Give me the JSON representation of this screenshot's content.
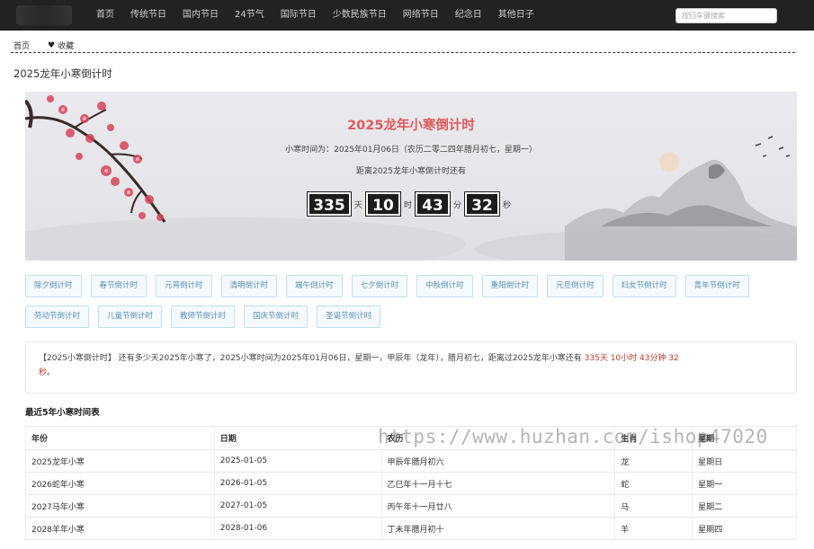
{
  "nav": {
    "items": [
      "首页",
      "传统节日",
      "国内节日",
      "24节气",
      "国际节日",
      "少数民族节日",
      "网络节日",
      "纪念日",
      "其他日子"
    ],
    "search_placeholder": "按回车键搜索"
  },
  "breadcrumb": {
    "home": "首页",
    "favorite": "收藏"
  },
  "page_title": "2025龙年小寒倒计时",
  "banner": {
    "title": "2025龙年小寒倒计时",
    "time_line": "小寒时间为：2025年01月06日（农历二零二四年腊月初七，星期一）",
    "remaining_line": "距离2025龙年小寒倒计时还有",
    "countdown": {
      "days": "335",
      "days_unit": "天",
      "hours": "10",
      "hours_unit": "时",
      "minutes": "43",
      "minutes_unit": "分",
      "seconds": "32",
      "seconds_unit": "秒"
    }
  },
  "festival_buttons": {
    "row1": [
      "除夕倒计时",
      "春节倒计时",
      "元宵倒计时",
      "清明倒计时",
      "端午倒计时",
      "七夕倒计时",
      "中秋倒计时",
      "重阳倒计时",
      "元旦倒计时",
      "妇女节倒计时",
      "青年节倒计时"
    ],
    "row2": [
      "劳动节倒计时",
      "儿童节倒计时",
      "教师节倒计时",
      "国庆节倒计时",
      "圣诞节倒计时"
    ]
  },
  "description": {
    "text": "【2025小寒倒计时】 还有多少天2025年小寒了，2025小寒时间为2025年01月06日，星期一，甲辰年（龙年），腊月初七，距离过2025龙年小寒还有 ",
    "highlight_main": "335天 10小时 43分钟 32",
    "highlight_tail": "秒",
    "end": "。"
  },
  "table": {
    "title": "最近5年小寒时间表",
    "headers": [
      "年份",
      "日期",
      "农历",
      "生肖",
      "星期"
    ],
    "rows": [
      [
        "2025龙年小寒",
        "2025-01-05",
        "甲辰年腊月初六",
        "龙",
        "星期日"
      ],
      [
        "2026蛇年小寒",
        "2026-01-05",
        "乙巳年十一月十七",
        "蛇",
        "星期一"
      ],
      [
        "2027马年小寒",
        "2027-01-05",
        "丙午年十一月廿八",
        "马",
        "星期二"
      ],
      [
        "2028羊年小寒",
        "2028-01-06",
        "丁未年腊月初十",
        "羊",
        "星期四"
      ]
    ]
  },
  "watermark": "https://www.huzhan.com/ishop47020",
  "colors": {
    "topbar": "#222222",
    "title_red": "#e05a5a",
    "highlight": "#c0392b",
    "button_border": "#bfe0f2",
    "button_text": "#5a8db0"
  }
}
